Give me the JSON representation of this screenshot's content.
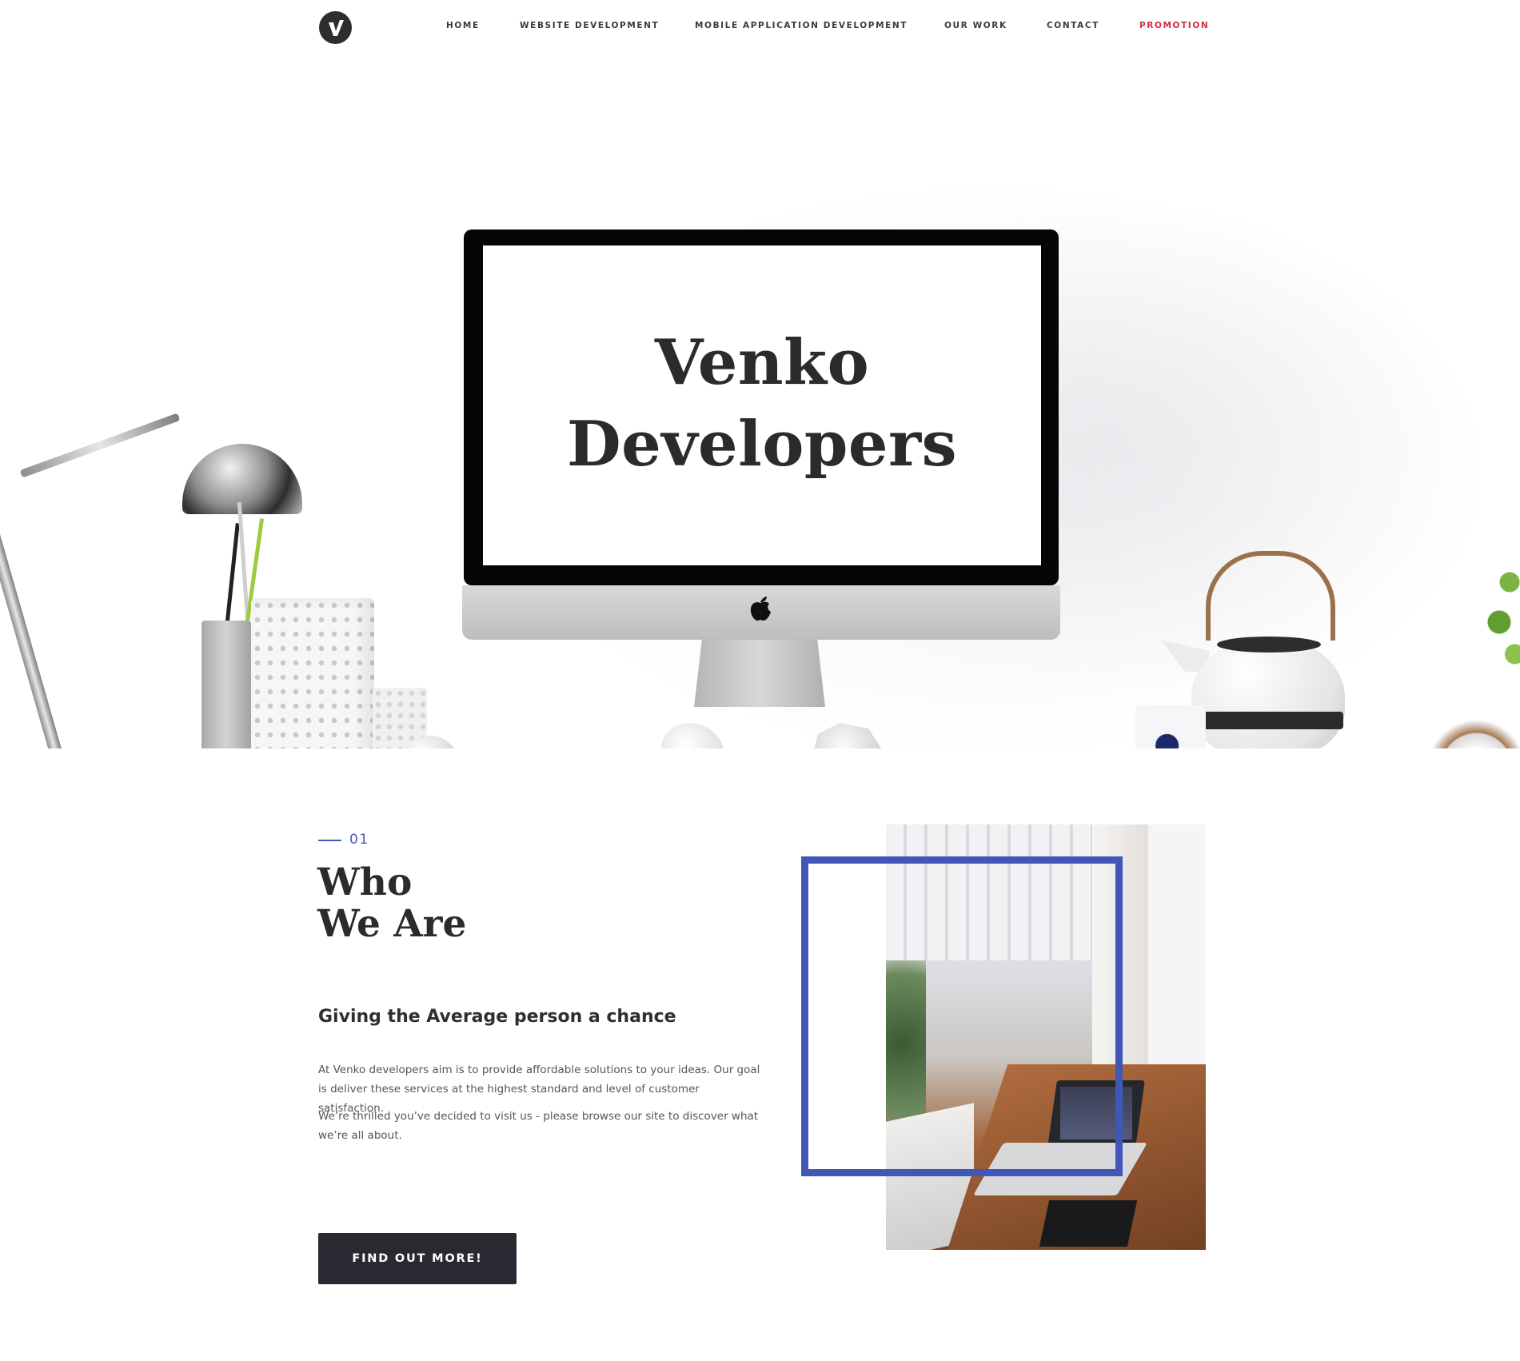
{
  "nav": {
    "logo_letter": "V",
    "items": [
      {
        "label": "HOME"
      },
      {
        "label": "WEBSITE DEVELOPMENT"
      },
      {
        "label": "MOBILE APPLICATION DEVELOPMENT"
      },
      {
        "label": "OUR WORK"
      },
      {
        "label": "CONTACT"
      },
      {
        "label": "PROMOTION"
      }
    ]
  },
  "hero": {
    "title_line1": "Venko",
    "title_line2": "Developers"
  },
  "about": {
    "number": "01",
    "heading_line1": "Who",
    "heading_line2": "We Are",
    "tagline": "Giving the Average person a chance",
    "paragraph1": "At Venko developers aim is to provide affordable solutions to your ideas. Our goal is deliver these services at the highest standard and level of customer satisfaction.",
    "paragraph2": "We’re thrilled you’ve decided to visit us - please browse our site to discover what we’re all about.",
    "cta_label": "FIND OUT MORE!"
  },
  "colors": {
    "accent_blue": "#4057b8",
    "promo_red": "#d3293f",
    "button_dark": "#2a2831"
  },
  "icons": {
    "logo": "venko-logo-icon",
    "apple": "apple-logo-icon"
  }
}
